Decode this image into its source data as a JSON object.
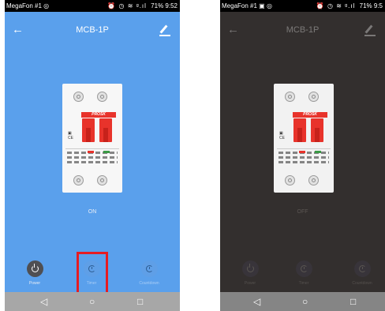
{
  "screens": [
    {
      "status": {
        "carrier": "MegaFon #1",
        "icons": "◎",
        "right_icons": "⏰ ◷ ≋ ᵍ.ıl",
        "battery": "71%",
        "time": "9:52"
      },
      "title": "MCB-1P",
      "state": "ON",
      "controls": {
        "power": "Power",
        "timer": "Timer",
        "countdown": "Countdown"
      },
      "brand": "PROSK"
    },
    {
      "status": {
        "carrier": "MegaFon #1",
        "icons": "▣ ◎",
        "right_icons": "⏰ ◷ ≋ ᵍ.ıl",
        "battery": "71%",
        "time": "9:5"
      },
      "title": "MCB-1P",
      "state": "OFF",
      "controls": {
        "power": "Power",
        "timer": "Timer",
        "countdown": "Countdown"
      },
      "brand": "PROSK"
    }
  ],
  "colors": {
    "on_background": "#5aa0ec",
    "off_background": "#332f2e",
    "highlight": "#e51c23",
    "lever": "#e8332b"
  },
  "icons": {
    "back": "back-arrow-icon",
    "edit": "edit-pen-icon",
    "power": "power-icon",
    "timer": "clock-icon",
    "countdown": "clock-icon",
    "nav_back": "triangle-back-icon",
    "nav_home": "circle-home-icon",
    "nav_recent": "square-recent-icon"
  }
}
